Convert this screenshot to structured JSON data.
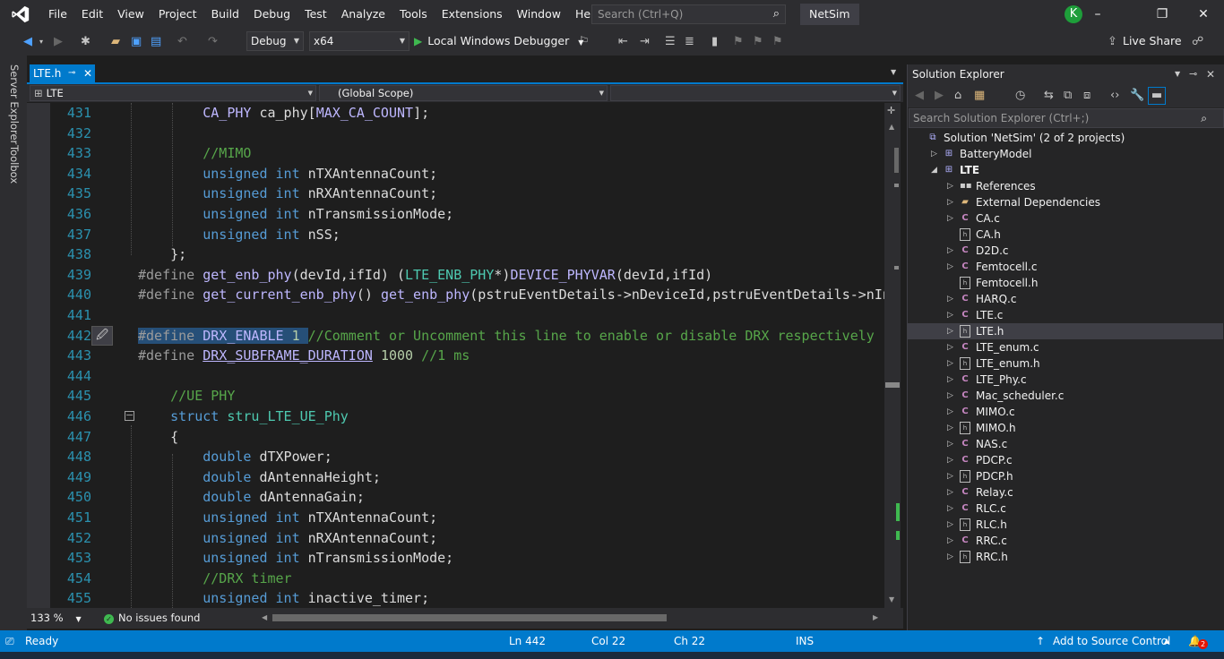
{
  "menu": [
    "File",
    "Edit",
    "View",
    "Project",
    "Build",
    "Debug",
    "Test",
    "Analyze",
    "Tools",
    "Extensions",
    "Window",
    "Help"
  ],
  "search": {
    "placeholder": "Search (Ctrl+Q)"
  },
  "solution_name": "NetSim",
  "user_initial": "K",
  "window_controls": {
    "minimize": "–",
    "restore": "❐",
    "close": "✕"
  },
  "toolbar": {
    "configuration": "Debug",
    "platform": "x64",
    "run_label": "Local Windows Debugger",
    "live_share": "Live Share"
  },
  "left_tabs": [
    "Server Explorer",
    "Toolbox"
  ],
  "document": {
    "tab_name": "LTE.h",
    "project_scope": "LTE",
    "member_scope": "(Global Scope)"
  },
  "code_lines": [
    {
      "n": "431",
      "html": "        <span class=\"mac\">CA_PHY</span> ca_phy[<span class=\"mac\">MAX_CA_COUNT</span>];"
    },
    {
      "n": "432",
      "html": ""
    },
    {
      "n": "433",
      "html": "        <span class=\"cm\">//MIMO</span>"
    },
    {
      "n": "434",
      "html": "        <span class=\"kw\">unsigned</span> <span class=\"kw\">int</span> nTXAntennaCount;"
    },
    {
      "n": "435",
      "html": "        <span class=\"kw\">unsigned</span> <span class=\"kw\">int</span> nRXAntennaCount;"
    },
    {
      "n": "436",
      "html": "        <span class=\"kw\">unsigned</span> <span class=\"kw\">int</span> nTransmissionMode;"
    },
    {
      "n": "437",
      "html": "        <span class=\"kw\">unsigned</span> <span class=\"kw\">int</span> nSS;"
    },
    {
      "n": "438",
      "html": "    };"
    },
    {
      "n": "439",
      "html": "<span class=\"dfn\">#define</span> <span class=\"mac\">get_enb_phy</span>(devId,ifId) (<span class=\"ty\">LTE_ENB_PHY</span>*)<span class=\"mac\">DEVICE_PHYVAR</span>(devId,ifId)"
    },
    {
      "n": "440",
      "html": "<span class=\"dfn\">#define</span> <span class=\"mac\">get_current_enb_phy</span>() <span class=\"mac\">get_enb_phy</span>(pstruEventDetails->nDeviceId,pstruEventDetails->nInterfaceId)"
    },
    {
      "n": "441",
      "html": ""
    },
    {
      "n": "442",
      "html": "<span class=\"sel\"><span class=\"dfn\">#define</span> <span class=\"mac\">DRX_ENABLE</span> <span class=\"num\">1</span> </span><span class=\"cm\">//Comment or Uncomment this line to enable or disable DRX respectively</span>"
    },
    {
      "n": "443",
      "html": "<span class=\"dfn\">#define</span> <span class=\"mac\" style=\"text-decoration: underline;\">DRX_SUBFRAME_DURATION</span> <span class=\"num\">1000</span> <span class=\"cm\">//1 ms</span>"
    },
    {
      "n": "444",
      "html": ""
    },
    {
      "n": "445",
      "html": "    <span class=\"cm\">//UE PHY</span>"
    },
    {
      "n": "446",
      "html": "    <span class=\"kw\">struct</span> <span class=\"ty\">stru_LTE_UE_Phy</span>"
    },
    {
      "n": "447",
      "html": "    {"
    },
    {
      "n": "448",
      "html": "        <span class=\"kw\">double</span> dTXPower;"
    },
    {
      "n": "449",
      "html": "        <span class=\"kw\">double</span> dAntennaHeight;"
    },
    {
      "n": "450",
      "html": "        <span class=\"kw\">double</span> dAntennaGain;"
    },
    {
      "n": "451",
      "html": "        <span class=\"kw\">unsigned</span> <span class=\"kw\">int</span> nTXAntennaCount;"
    },
    {
      "n": "452",
      "html": "        <span class=\"kw\">unsigned</span> <span class=\"kw\">int</span> nRXAntennaCount;"
    },
    {
      "n": "453",
      "html": "        <span class=\"kw\">unsigned</span> <span class=\"kw\">int</span> nTransmissionMode;"
    },
    {
      "n": "454",
      "html": "        <span class=\"cm\">//DRX timer</span>"
    },
    {
      "n": "455",
      "html": "        <span class=\"kw\">unsigned</span> <span class=\"kw\">int</span> inactive_timer;"
    }
  ],
  "editor_status": {
    "zoom": "133 %",
    "issues": "No issues found"
  },
  "solution_explorer": {
    "title": "Solution Explorer",
    "search_placeholder": "Search Solution Explorer (Ctrl+;)",
    "items": [
      {
        "label": "Solution 'NetSim' (2 of 2 projects)",
        "kind": "solution",
        "depth": 0,
        "expand": ""
      },
      {
        "label": "BatteryModel",
        "kind": "proj",
        "depth": 1,
        "expand": "closed"
      },
      {
        "label": "LTE",
        "kind": "proj",
        "depth": 1,
        "expand": "open",
        "bold": true
      },
      {
        "label": "References",
        "kind": "ref",
        "depth": 2,
        "expand": "closed"
      },
      {
        "label": "External Dependencies",
        "kind": "ext",
        "depth": 2,
        "expand": "closed"
      },
      {
        "label": "CA.c",
        "kind": "c",
        "depth": 2,
        "expand": "closed"
      },
      {
        "label": "CA.h",
        "kind": "h",
        "depth": 2,
        "expand": ""
      },
      {
        "label": "D2D.c",
        "kind": "c",
        "depth": 2,
        "expand": "closed"
      },
      {
        "label": "Femtocell.c",
        "kind": "c",
        "depth": 2,
        "expand": "closed"
      },
      {
        "label": "Femtocell.h",
        "kind": "h",
        "depth": 2,
        "expand": ""
      },
      {
        "label": "HARQ.c",
        "kind": "c",
        "depth": 2,
        "expand": "closed"
      },
      {
        "label": "LTE.c",
        "kind": "c",
        "depth": 2,
        "expand": "closed"
      },
      {
        "label": "LTE.h",
        "kind": "h",
        "depth": 2,
        "expand": "closed",
        "selected": true
      },
      {
        "label": "LTE_enum.c",
        "kind": "c",
        "depth": 2,
        "expand": "closed"
      },
      {
        "label": "LTE_enum.h",
        "kind": "h",
        "depth": 2,
        "expand": "closed"
      },
      {
        "label": "LTE_Phy.c",
        "kind": "c",
        "depth": 2,
        "expand": "closed"
      },
      {
        "label": "Mac_scheduler.c",
        "kind": "c",
        "depth": 2,
        "expand": "closed"
      },
      {
        "label": "MIMO.c",
        "kind": "c",
        "depth": 2,
        "expand": "closed"
      },
      {
        "label": "MIMO.h",
        "kind": "h",
        "depth": 2,
        "expand": "closed"
      },
      {
        "label": "NAS.c",
        "kind": "c",
        "depth": 2,
        "expand": "closed"
      },
      {
        "label": "PDCP.c",
        "kind": "c",
        "depth": 2,
        "expand": "closed"
      },
      {
        "label": "PDCP.h",
        "kind": "h",
        "depth": 2,
        "expand": "closed"
      },
      {
        "label": "Relay.c",
        "kind": "c",
        "depth": 2,
        "expand": "closed"
      },
      {
        "label": "RLC.c",
        "kind": "c",
        "depth": 2,
        "expand": "closed"
      },
      {
        "label": "RLC.h",
        "kind": "h",
        "depth": 2,
        "expand": "closed"
      },
      {
        "label": "RRC.c",
        "kind": "c",
        "depth": 2,
        "expand": "closed"
      },
      {
        "label": "RRC.h",
        "kind": "h",
        "depth": 2,
        "expand": "closed"
      }
    ]
  },
  "statusbar": {
    "ready": "Ready",
    "ln": "Ln 442",
    "col": "Col 22",
    "ch": "Ch 22",
    "mode": "INS",
    "source_control": "Add to Source Control",
    "notifications": "2"
  }
}
